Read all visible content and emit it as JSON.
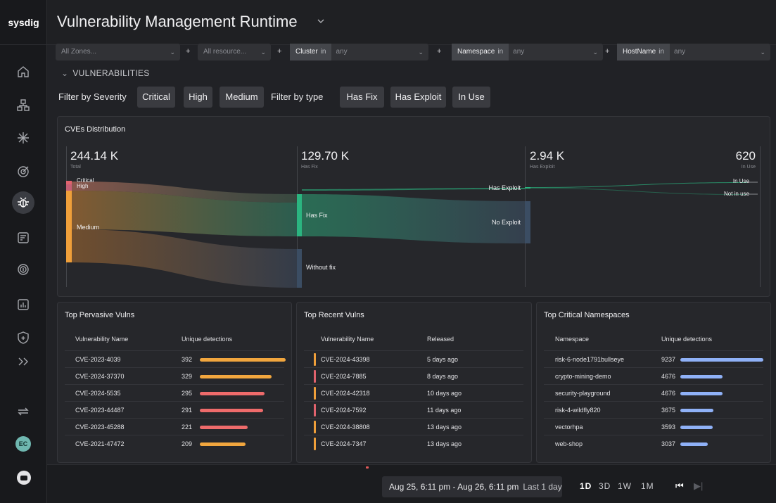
{
  "app": {
    "logo": "sysdig",
    "title": "Vulnerability Management Runtime"
  },
  "colors": {
    "critical": "#e0626d",
    "high": "#ef9f3a",
    "hasfix": "#2bb580",
    "nofix": "#3b4d63",
    "bar_red": "#ee6b6b",
    "bar_orange": "#f1a63e",
    "bar_blue": "#8fb1f7"
  },
  "sidebar": {
    "icons": [
      "home-icon",
      "grid-icon",
      "sparkle-icon",
      "target-icon",
      "bug-icon",
      "report-icon",
      "fingerprint-icon",
      "chart-icon",
      "shield-icon",
      "expand-icon",
      "swap-icon"
    ],
    "avatar": "EC"
  },
  "filters": {
    "zones": "All Zones...",
    "resources": "All resource...",
    "cluster": {
      "key": "Cluster",
      "op": "in",
      "value": "any"
    },
    "namespace": {
      "key": "Namespace",
      "op": "in",
      "value": "any"
    },
    "hostname": {
      "key": "HostName",
      "op": "in",
      "value": "any"
    },
    "plus": "+"
  },
  "section": {
    "caret": "⌄",
    "label": "VULNERABILITIES"
  },
  "severity": {
    "label": "Filter by Severity",
    "chips": [
      "Critical",
      "High",
      "Medium"
    ]
  },
  "type": {
    "label": "Filter by type",
    "chips": [
      "Has Fix",
      "Has Exploit",
      "In Use"
    ]
  },
  "cves": {
    "title": "CVEs Distribution",
    "cols": [
      {
        "value": "244.14 K",
        "label": "Total"
      },
      {
        "value": "129.70 K",
        "label": "Has Fix"
      },
      {
        "value": "2.94 K",
        "label": "Has Exploit"
      },
      {
        "value": "620",
        "label": "In Use"
      }
    ],
    "nodes": {
      "critical": "Critical",
      "high": "High",
      "medium": "Medium",
      "hasfix": "Has Fix",
      "withoutfix": "Without fix",
      "hasexploit": "Has Exploit",
      "noexploit": "No Exploit",
      "inuse": "In Use",
      "notinuse": "Not in use"
    }
  },
  "pervasive": {
    "title": "Top Pervasive Vulns",
    "headers": [
      "Vulnerability Name",
      "Unique detections"
    ],
    "rows": [
      {
        "name": "CVE-2023-4039",
        "count": "392",
        "pct": 1.0,
        "color": "orange"
      },
      {
        "name": "CVE-2024-37370",
        "count": "329",
        "pct": 0.84,
        "color": "orange"
      },
      {
        "name": "CVE-2024-5535",
        "count": "295",
        "pct": 0.75,
        "color": "red"
      },
      {
        "name": "CVE-2023-44487",
        "count": "291",
        "pct": 0.74,
        "color": "red"
      },
      {
        "name": "CVE-2023-45288",
        "count": "221",
        "pct": 0.56,
        "color": "red"
      },
      {
        "name": "CVE-2021-47472",
        "count": "209",
        "pct": 0.53,
        "color": "orange"
      }
    ]
  },
  "recent": {
    "title": "Top Recent Vulns",
    "headers": [
      "Vulnerability Name",
      "Released"
    ],
    "rows": [
      {
        "name": "CVE-2024-43398",
        "released": "5 days ago",
        "color": "orange"
      },
      {
        "name": "CVE-2024-7885",
        "released": "8 days ago",
        "color": "red"
      },
      {
        "name": "CVE-2024-42318",
        "released": "10 days ago",
        "color": "orange"
      },
      {
        "name": "CVE-2024-7592",
        "released": "11 days ago",
        "color": "red"
      },
      {
        "name": "CVE-2024-38808",
        "released": "13 days ago",
        "color": "orange"
      },
      {
        "name": "CVE-2024-7347",
        "released": "13 days ago",
        "color": "orange"
      }
    ]
  },
  "namespaces": {
    "title": "Top Critical Namespaces",
    "headers": [
      "Namespace",
      "Unique detections"
    ],
    "rows": [
      {
        "name": "risk-6-node1791bullseye",
        "count": "9237",
        "pct": 1.0
      },
      {
        "name": "crypto-mining-demo",
        "count": "4676",
        "pct": 0.51
      },
      {
        "name": "security-playground",
        "count": "4676",
        "pct": 0.51
      },
      {
        "name": "risk-4-wildfly820",
        "count": "3675",
        "pct": 0.4
      },
      {
        "name": "vectorhpa",
        "count": "3593",
        "pct": 0.39
      },
      {
        "name": "web-shop",
        "count": "3037",
        "pct": 0.33
      }
    ]
  },
  "timebar": {
    "range": "Aug 25, 6:11 pm - Aug 26, 6:11 pm",
    "last": "Last 1 day",
    "options": [
      "1D",
      "3D",
      "1W",
      "1M"
    ],
    "selected": "1D",
    "prev": "⏮",
    "next": "▶|"
  }
}
